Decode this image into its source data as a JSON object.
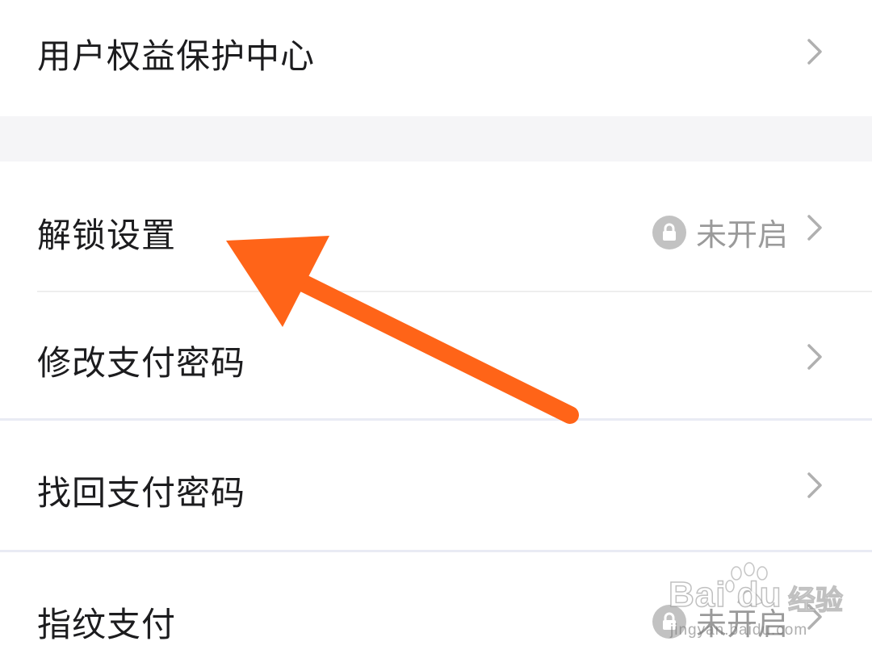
{
  "menu": {
    "items": [
      {
        "label": "用户权益保护中心"
      },
      {
        "label": "解锁设置",
        "status": "未开启"
      },
      {
        "label": "修改支付密码"
      },
      {
        "label": "找回支付密码"
      },
      {
        "label": "指纹支付",
        "status": "未开启"
      }
    ]
  },
  "colors": {
    "annotation_arrow": "#ff6418",
    "status_text": "#9a9a9a",
    "section_gap": "#f5f5f7"
  },
  "watermark": {
    "logo_text": "Bai du",
    "jingyan_text": "经验",
    "url": "jingyan.baidu.com"
  }
}
